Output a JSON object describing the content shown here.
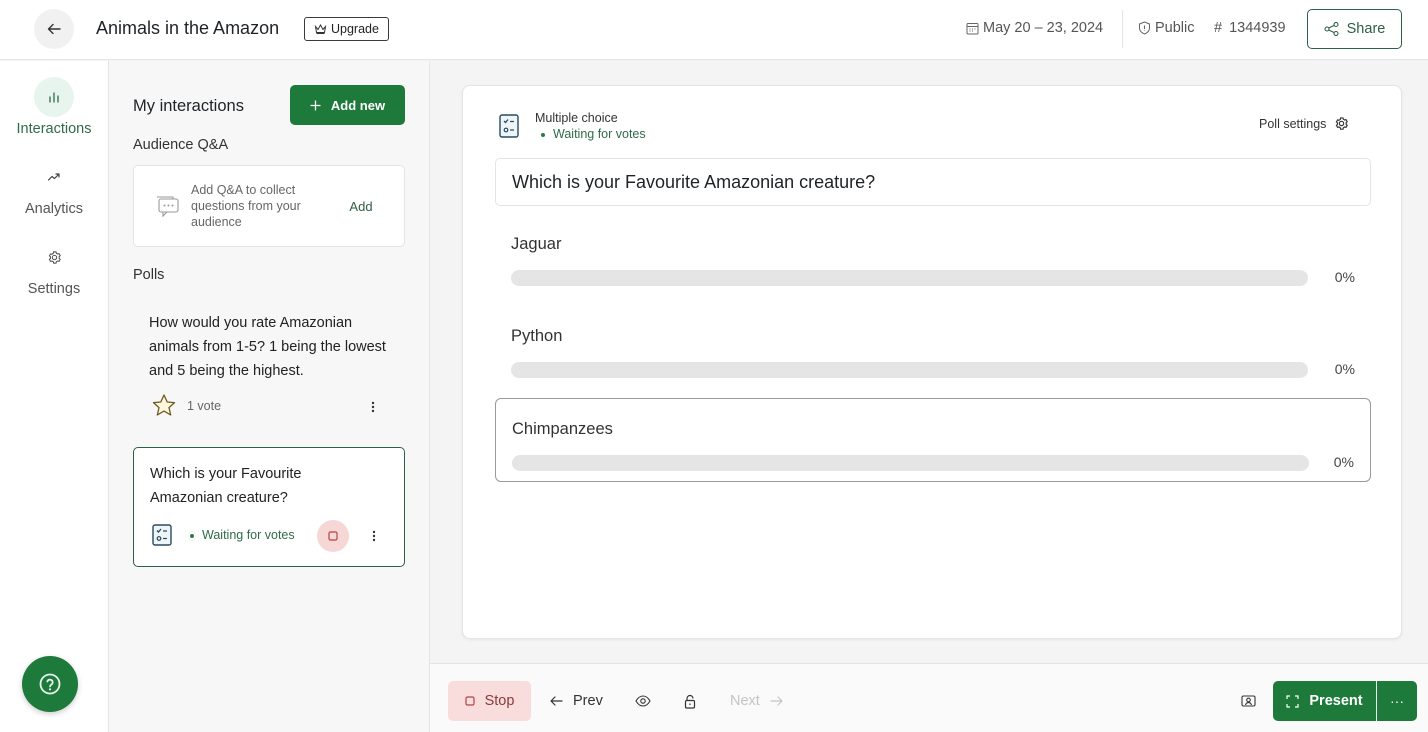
{
  "header": {
    "title": "Animals in the Amazon",
    "upgrade_label": "Upgrade",
    "date": "May 20 – 23, 2024",
    "visibility": "Public",
    "event_code": "1344939",
    "share_label": "Share"
  },
  "nav": {
    "items": [
      {
        "label": "Interactions",
        "icon": "bar-chart-icon",
        "active": true
      },
      {
        "label": "Analytics",
        "icon": "trending-up-icon",
        "active": false
      },
      {
        "label": "Settings",
        "icon": "gear-icon",
        "active": false
      }
    ],
    "help_icon": "question-circle-icon"
  },
  "panel": {
    "title": "My interactions",
    "add_new_label": "Add new",
    "qa_section_label": "Audience Q&A",
    "qa_card": {
      "description": "Add Q&A to collect questions from your audience",
      "add_label": "Add"
    },
    "polls_section_label": "Polls",
    "polls": [
      {
        "question": "How would you rate Amazonian animals from 1-5? 1 being the lowest and 5 being the highest.",
        "type_icon": "star-icon",
        "meta": "1 vote",
        "selected": false
      },
      {
        "question": "Which is your Favourite Amazonian creature?",
        "type_icon": "multiple-choice-icon",
        "meta": "Waiting for votes",
        "selected": true
      }
    ]
  },
  "main": {
    "poll_type": "Multiple choice",
    "status": "Waiting for votes",
    "poll_settings_label": "Poll settings",
    "question": "Which is your Favourite Amazonian creature?",
    "options": [
      {
        "label": "Jaguar",
        "percent": 0,
        "percent_label": "0%"
      },
      {
        "label": "Python",
        "percent": 0,
        "percent_label": "0%"
      },
      {
        "label": "Chimpanzees",
        "percent": 0,
        "percent_label": "0%"
      }
    ]
  },
  "bottombar": {
    "stop_label": "Stop",
    "prev_label": "Prev",
    "next_label": "Next",
    "present_label": "Present",
    "more_label": "···"
  },
  "colors": {
    "brand_green": "#1d7a3a",
    "status_green": "#2f6b4a",
    "stop_bg": "#f9dcdc",
    "track_gray": "#e5e5e5"
  }
}
